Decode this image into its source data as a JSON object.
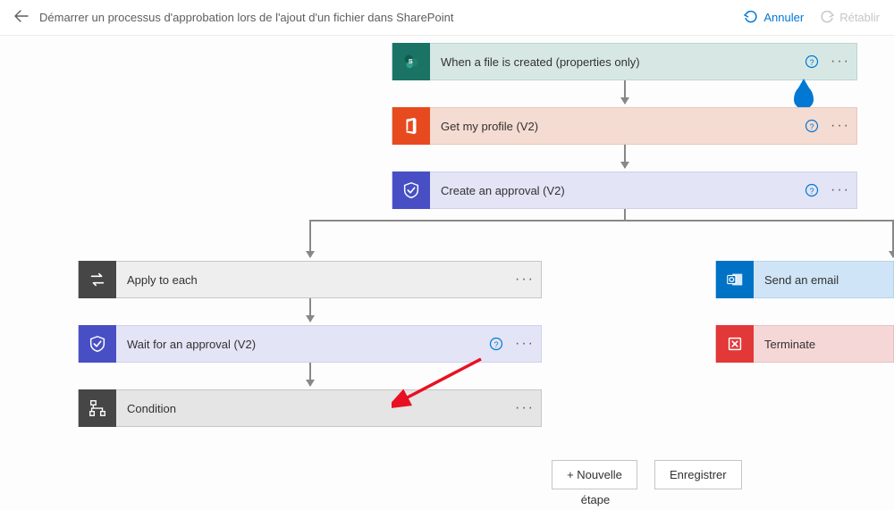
{
  "header": {
    "title": "Démarrer un processus d'approbation lors de l'ajout d'un fichier dans SharePoint",
    "undo": "Annuler",
    "redo": "Rétablir"
  },
  "cards": {
    "trigger": {
      "label": "When a file is created (properties only)"
    },
    "profile": {
      "label": "Get my profile (V2)"
    },
    "createApproval": {
      "label": "Create an approval (V2)"
    },
    "applyEach": {
      "label": "Apply to each"
    },
    "waitApproval": {
      "label": "Wait for an approval (V2)"
    },
    "condition": {
      "label": "Condition"
    },
    "sendEmail": {
      "label": "Send an email"
    },
    "terminate": {
      "label": "Terminate"
    }
  },
  "footer": {
    "newStep": "+ Nouvelle",
    "newStepLine2": "étape",
    "save": "Enregistrer"
  }
}
